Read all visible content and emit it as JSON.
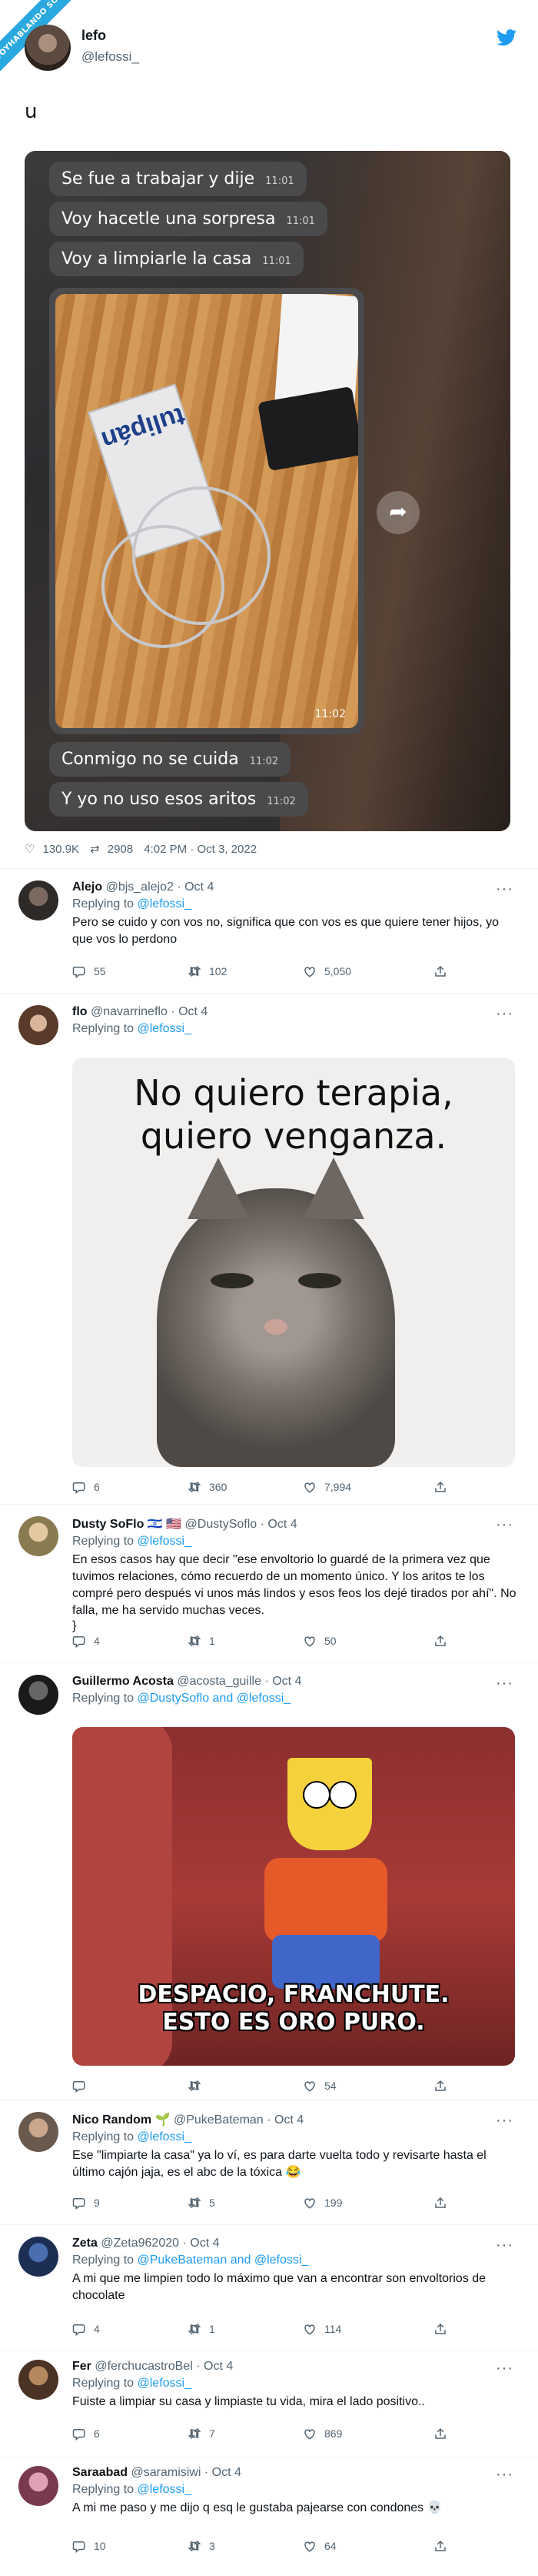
{
  "badge": "VOYHABLANDO SOLO",
  "main": {
    "name": "lefo",
    "handle": "@lefossi_",
    "text": "u",
    "messages": [
      {
        "text": "Se fue a trabajar y dije",
        "time": "11:01"
      },
      {
        "text": "Voy hacetle una sorpresa",
        "time": "11:01"
      },
      {
        "text": "Voy a limpiarle la casa",
        "time": "11:01"
      },
      {
        "text": "Conmigo no se cuida",
        "time": "11:02"
      },
      {
        "text": "Y yo no uso esos aritos",
        "time": "11:02"
      }
    ],
    "photo_time": "11:02",
    "wrapper_brand": "tulipán",
    "likes": "130.9K",
    "retweets": "2908",
    "timestamp": "4:02 PM · Oct 3, 2022"
  },
  "replies": [
    {
      "name": "Alejo",
      "handle": "@bjs_alejo2",
      "date": "Oct 4",
      "replying_prefix": "Replying to",
      "replying_to": "@lefossi_",
      "text": "Pero se cuido y con vos no, significa que con vos es que quiere tener hijos, yo que vos lo perdono",
      "replies": "55",
      "retweets": "102",
      "likes": "5,050"
    },
    {
      "name": "flo",
      "handle": "@navarrineflo",
      "date": "Oct 4",
      "replying_prefix": "Replying to",
      "replying_to": "@lefossi_",
      "meme_text": "No quiero terapia, quiero venganza.",
      "replies": "6",
      "retweets": "360",
      "likes": "7,994"
    },
    {
      "name": "Dusty SoFlo",
      "flags": "🇮🇱 🇺🇸",
      "handle": "@DustySoflo",
      "date": "Oct 4",
      "replying_prefix": "Replying to",
      "replying_to": "@lefossi_",
      "text": "En esos casos hay que decir \"ese envoltorio lo guardé de la primera vez que tuvimos relaciones, cómo recuerdo de un momento único. Y los aritos te los compré pero después vi unos más lindos y esos feos los dejé tirados por ahí\". No falla, me ha servido muchas veces.",
      "replies": "4",
      "retweets": "1",
      "likes": "50"
    },
    {
      "name": "Guillermo Acosta",
      "handle": "@acosta_guille",
      "date": "Oct 4",
      "replying_prefix": "Replying to",
      "replying_to": "@DustySoflo and @lefossi_",
      "meme_text": "DESPACIO, FRANCHUTE. ESTO ES ORO PURO.",
      "replies": "",
      "retweets": "",
      "likes": "54"
    },
    {
      "name": "Nico Random",
      "emoji": "🌱",
      "handle": "@PukeBateman",
      "date": "Oct 4",
      "replying_prefix": "Replying to",
      "replying_to": "@lefossi_",
      "text": "Ese \"limpiarte la casa\" ya lo ví, es para darte vuelta todo y revisarte hasta el último cajón jaja, es el abc de la tóxica 😂",
      "replies": "9",
      "retweets": "5",
      "likes": "199"
    },
    {
      "name": "Zeta",
      "handle": "@Zeta962020",
      "date": "Oct 4",
      "replying_prefix": "Replying to",
      "replying_to": "@PukeBateman and @lefossi_",
      "text": "A mi que me limpien todo lo máximo que van a encontrar son envoltorios de chocolate",
      "replies": "4",
      "retweets": "1",
      "likes": "114"
    },
    {
      "name": "Fer",
      "handle": "@ferchucastroBel",
      "date": "Oct 4",
      "replying_prefix": "Replying to",
      "replying_to": "@lefossi_",
      "text": "Fuiste a limpiar su casa y limpiaste tu vida, mira el lado positivo..",
      "replies": "6",
      "retweets": "7",
      "likes": "869"
    },
    {
      "name": "Saraabad",
      "handle": "@saramisiwi",
      "date": "Oct 4",
      "replying_prefix": "Replying to",
      "replying_to": "@lefossi_",
      "text": "A mi me paso y me dijo q esq le gustaba pajearse con condones 💀",
      "replies": "10",
      "retweets": "3",
      "likes": "64"
    }
  ],
  "colors": {
    "link": "#1d9bf0",
    "muted": "#536471",
    "twitter": "#1d9bf0"
  }
}
